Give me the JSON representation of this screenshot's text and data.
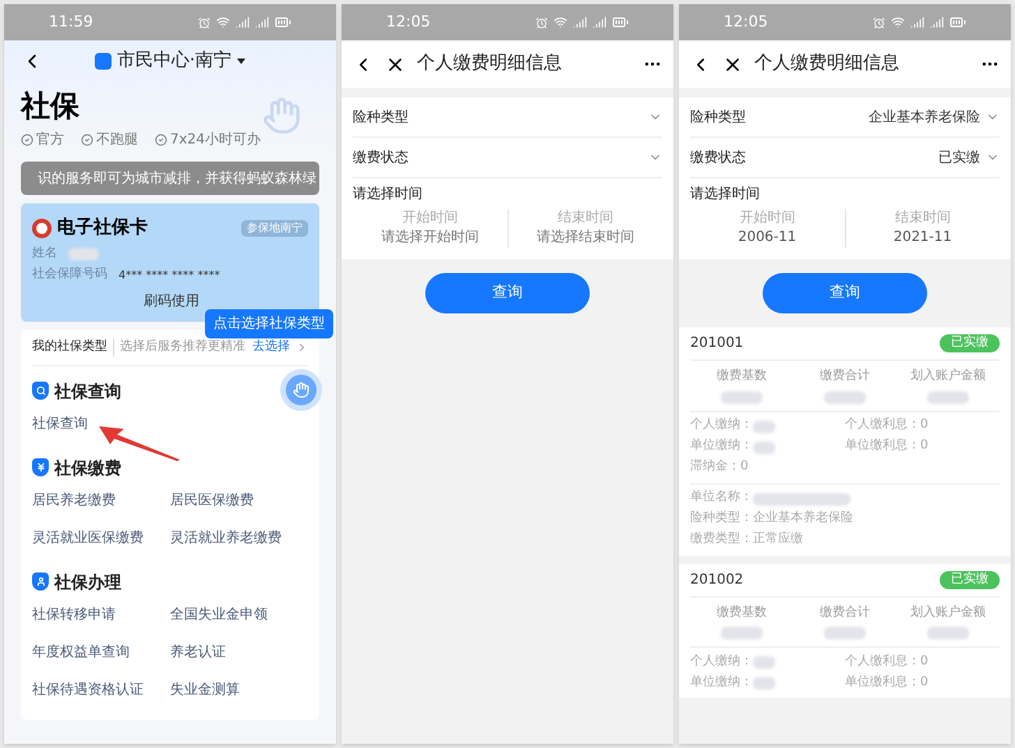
{
  "home": {
    "status_time": "11:59",
    "location": "市民中心·南宁",
    "title": "社保",
    "tags": [
      "官方",
      "不跑腿",
      "7x24小时可办"
    ],
    "notice": "识的服务即可为城市减排，并获得蚂蚁森林绿",
    "card": {
      "title": "电子社保卡",
      "badge": "参保地南宁",
      "name_label": "姓名",
      "id_label": "社会保障号码",
      "id_value": "4*** **** **** ****",
      "action": "刷码使用"
    },
    "tooltip": "点击选择社保类型",
    "type_row": {
      "label": "我的社保类型",
      "hint": "选择后服务推荐更精准",
      "action": "去选择"
    },
    "sections": [
      {
        "title": "社保查询",
        "kind": "search",
        "items": [
          "社保查询"
        ]
      },
      {
        "title": "社保缴费",
        "kind": "payment",
        "items": [
          "居民养老缴费",
          "居民医保缴费",
          "灵活就业医保缴费",
          "灵活就业养老缴费"
        ]
      },
      {
        "title": "社保办理",
        "kind": "service",
        "items": [
          "社保转移申请",
          "全国失业金申领",
          "年度权益单查询",
          "养老认证",
          "社保待遇资格认证",
          "失业金测算"
        ]
      }
    ]
  },
  "query_form": {
    "status_time": "12:05",
    "title": "个人缴费明细信息",
    "fields": [
      {
        "label": "险种类型"
      },
      {
        "label": "缴费状态"
      }
    ],
    "time_label": "请选择时间",
    "start": {
      "label": "开始时间",
      "placeholder": "请选择开始时间"
    },
    "end": {
      "label": "结束时间",
      "placeholder": "请选择结束时间"
    },
    "button": "查询"
  },
  "query_result": {
    "status_time": "12:05",
    "title": "个人缴费明细信息",
    "fields": [
      {
        "label": "险种类型",
        "value": "企业基本养老保险"
      },
      {
        "label": "缴费状态",
        "value": "已实缴"
      }
    ],
    "time_label": "请选择时间",
    "start": {
      "label": "开始时间",
      "value": "2006-11"
    },
    "end": {
      "label": "结束时间",
      "value": "2021-11"
    },
    "button": "查询",
    "records": [
      {
        "period": "201001",
        "status": "已实缴",
        "columns": [
          "缴费基数",
          "缴费合计",
          "划入账户金额"
        ],
        "details": [
          {
            "label": "个人缴纳：",
            "blurred": true
          },
          {
            "label": "个人缴利息：",
            "value": "0"
          },
          {
            "label": "单位缴纳：",
            "blurred": true
          },
          {
            "label": "单位缴利息：",
            "value": "0"
          },
          {
            "label": "滞纳金：",
            "value": "0"
          }
        ],
        "info": [
          {
            "label": "单位名称：",
            "blurred": true
          },
          {
            "label": "险种类型：",
            "value": "企业基本养老保险"
          },
          {
            "label": "缴费类型：",
            "value": "正常应缴"
          }
        ]
      },
      {
        "period": "201002",
        "status": "已实缴",
        "columns": [
          "缴费基数",
          "缴费合计",
          "划入账户金额"
        ],
        "details": [
          {
            "label": "个人缴纳：",
            "blurred": true
          },
          {
            "label": "个人缴利息：",
            "value": "0"
          },
          {
            "label": "单位缴纳：",
            "blurred": true
          },
          {
            "label": "单位缴利息：",
            "value": "0"
          }
        ]
      }
    ]
  }
}
